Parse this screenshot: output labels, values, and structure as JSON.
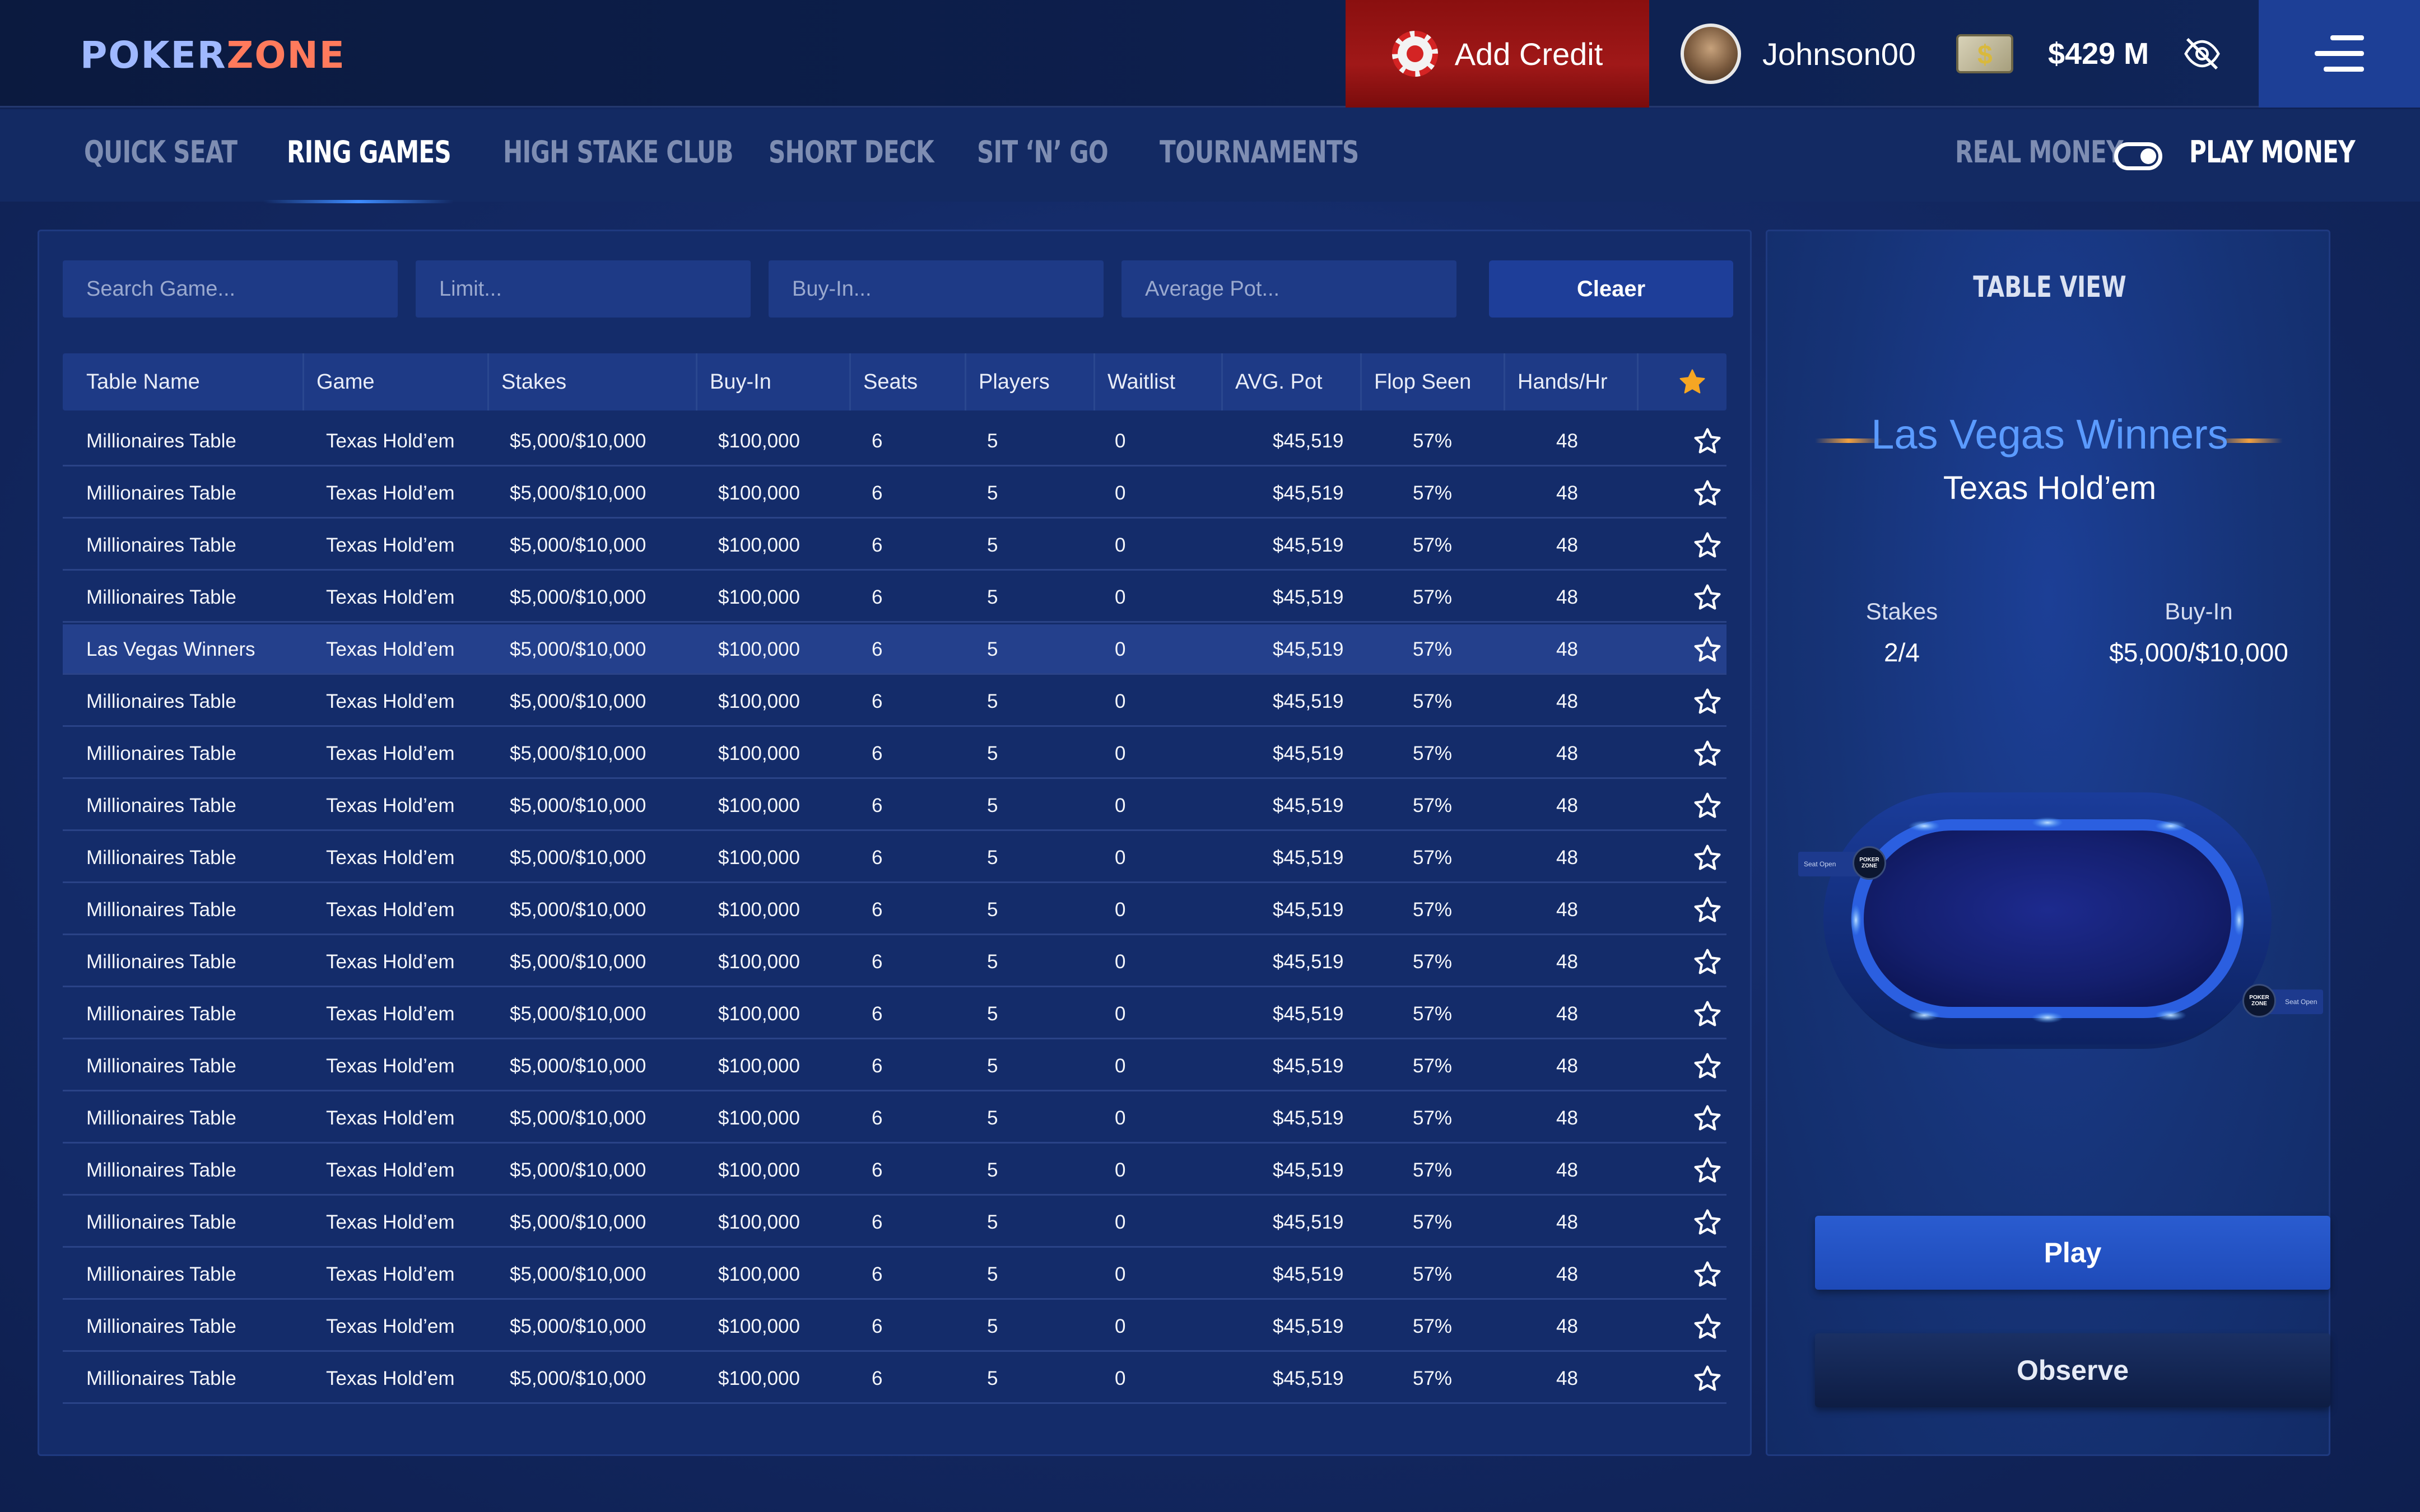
{
  "brand": {
    "logo_part1": "POKER",
    "logo_part2": "ZONE"
  },
  "header": {
    "add_credit_label": "Add Credit",
    "username": "Johnson00",
    "balance": "$429 M"
  },
  "nav": {
    "tabs": [
      {
        "label": "QUICK SEAT",
        "active": false
      },
      {
        "label": "RING GAMES",
        "active": true
      },
      {
        "label": "HIGH STAKE CLUB",
        "active": false
      },
      {
        "label": "SHORT DECK",
        "active": false
      },
      {
        "label": "SIT ‘N’ GO",
        "active": false
      },
      {
        "label": "TOURNAMENTS",
        "active": false
      }
    ],
    "real_money_label": "REAL MONEY",
    "play_money_label": "PLAY MONEY",
    "mode_selected": "PLAY MONEY"
  },
  "filters": {
    "search_placeholder": "Search Game...",
    "limit_placeholder": "Limit...",
    "buyin_placeholder": "Buy-In...",
    "avgpot_placeholder": "Average Pot...",
    "clear_label": "Cleaer"
  },
  "table": {
    "columns": [
      "Table Name",
      "Game",
      "Stakes",
      "Buy-In",
      "Seats",
      "Players",
      "Waitlist",
      "AVG. Pot",
      "Flop Seen",
      "Hands/Hr"
    ],
    "header_star_color": "#f5a623",
    "rows": [
      [
        "Millionaires Table",
        "Texas Hold’em",
        "$5,000/$10,000",
        "$100,000",
        "6",
        "5",
        "0",
        "$45,519",
        "57%",
        "48"
      ],
      [
        "Millionaires Table",
        "Texas Hold’em",
        "$5,000/$10,000",
        "$100,000",
        "6",
        "5",
        "0",
        "$45,519",
        "57%",
        "48"
      ],
      [
        "Millionaires Table",
        "Texas Hold’em",
        "$5,000/$10,000",
        "$100,000",
        "6",
        "5",
        "0",
        "$45,519",
        "57%",
        "48"
      ],
      [
        "Millionaires Table",
        "Texas Hold’em",
        "$5,000/$10,000",
        "$100,000",
        "6",
        "5",
        "0",
        "$45,519",
        "57%",
        "48"
      ],
      [
        "Las Vegas Winners",
        "Texas Hold’em",
        "$5,000/$10,000",
        "$100,000",
        "6",
        "5",
        "0",
        "$45,519",
        "57%",
        "48"
      ],
      [
        "Millionaires Table",
        "Texas Hold’em",
        "$5,000/$10,000",
        "$100,000",
        "6",
        "5",
        "0",
        "$45,519",
        "57%",
        "48"
      ],
      [
        "Millionaires Table",
        "Texas Hold’em",
        "$5,000/$10,000",
        "$100,000",
        "6",
        "5",
        "0",
        "$45,519",
        "57%",
        "48"
      ],
      [
        "Millionaires Table",
        "Texas Hold’em",
        "$5,000/$10,000",
        "$100,000",
        "6",
        "5",
        "0",
        "$45,519",
        "57%",
        "48"
      ],
      [
        "Millionaires Table",
        "Texas Hold’em",
        "$5,000/$10,000",
        "$100,000",
        "6",
        "5",
        "0",
        "$45,519",
        "57%",
        "48"
      ],
      [
        "Millionaires Table",
        "Texas Hold’em",
        "$5,000/$10,000",
        "$100,000",
        "6",
        "5",
        "0",
        "$45,519",
        "57%",
        "48"
      ],
      [
        "Millionaires Table",
        "Texas Hold’em",
        "$5,000/$10,000",
        "$100,000",
        "6",
        "5",
        "0",
        "$45,519",
        "57%",
        "48"
      ],
      [
        "Millionaires Table",
        "Texas Hold’em",
        "$5,000/$10,000",
        "$100,000",
        "6",
        "5",
        "0",
        "$45,519",
        "57%",
        "48"
      ],
      [
        "Millionaires Table",
        "Texas Hold’em",
        "$5,000/$10,000",
        "$100,000",
        "6",
        "5",
        "0",
        "$45,519",
        "57%",
        "48"
      ],
      [
        "Millionaires Table",
        "Texas Hold’em",
        "$5,000/$10,000",
        "$100,000",
        "6",
        "5",
        "0",
        "$45,519",
        "57%",
        "48"
      ],
      [
        "Millionaires Table",
        "Texas Hold’em",
        "$5,000/$10,000",
        "$100,000",
        "6",
        "5",
        "0",
        "$45,519",
        "57%",
        "48"
      ],
      [
        "Millionaires Table",
        "Texas Hold’em",
        "$5,000/$10,000",
        "$100,000",
        "6",
        "5",
        "0",
        "$45,519",
        "57%",
        "48"
      ],
      [
        "Millionaires Table",
        "Texas Hold’em",
        "$5,000/$10,000",
        "$100,000",
        "6",
        "5",
        "0",
        "$45,519",
        "57%",
        "48"
      ],
      [
        "Millionaires Table",
        "Texas Hold’em",
        "$5,000/$10,000",
        "$100,000",
        "6",
        "5",
        "0",
        "$45,519",
        "57%",
        "48"
      ],
      [
        "Millionaires Table",
        "Texas Hold’em",
        "$5,000/$10,000",
        "$100,000",
        "6",
        "5",
        "0",
        "$45,519",
        "57%",
        "48"
      ]
    ],
    "selected_row": 4
  },
  "table_view": {
    "title": "TABLE VIEW",
    "table_name": "Las Vegas Winners",
    "game": "Texas Hold’em",
    "stakes_label": "Stakes",
    "stakes_value": "2/4",
    "buyin_label": "Buy-In",
    "buyin_value": "$5,000/$10,000",
    "seat_open_label": "Seat Open",
    "seat_logo_text": "POKER ZONE",
    "play_label": "Play",
    "observe_label": "Observe"
  },
  "icons": {
    "add_credit": "poker-chip-icon",
    "cash": "cash-icon",
    "hide_balance": "eye-off-icon",
    "menu": "hamburger-menu-icon",
    "favorite": "star-icon"
  },
  "colors": {
    "accent_red": "#a01818",
    "accent_blue": "#1e4ab8",
    "brand_orange": "#ff7a5c",
    "title_blue": "#5b9bff"
  }
}
